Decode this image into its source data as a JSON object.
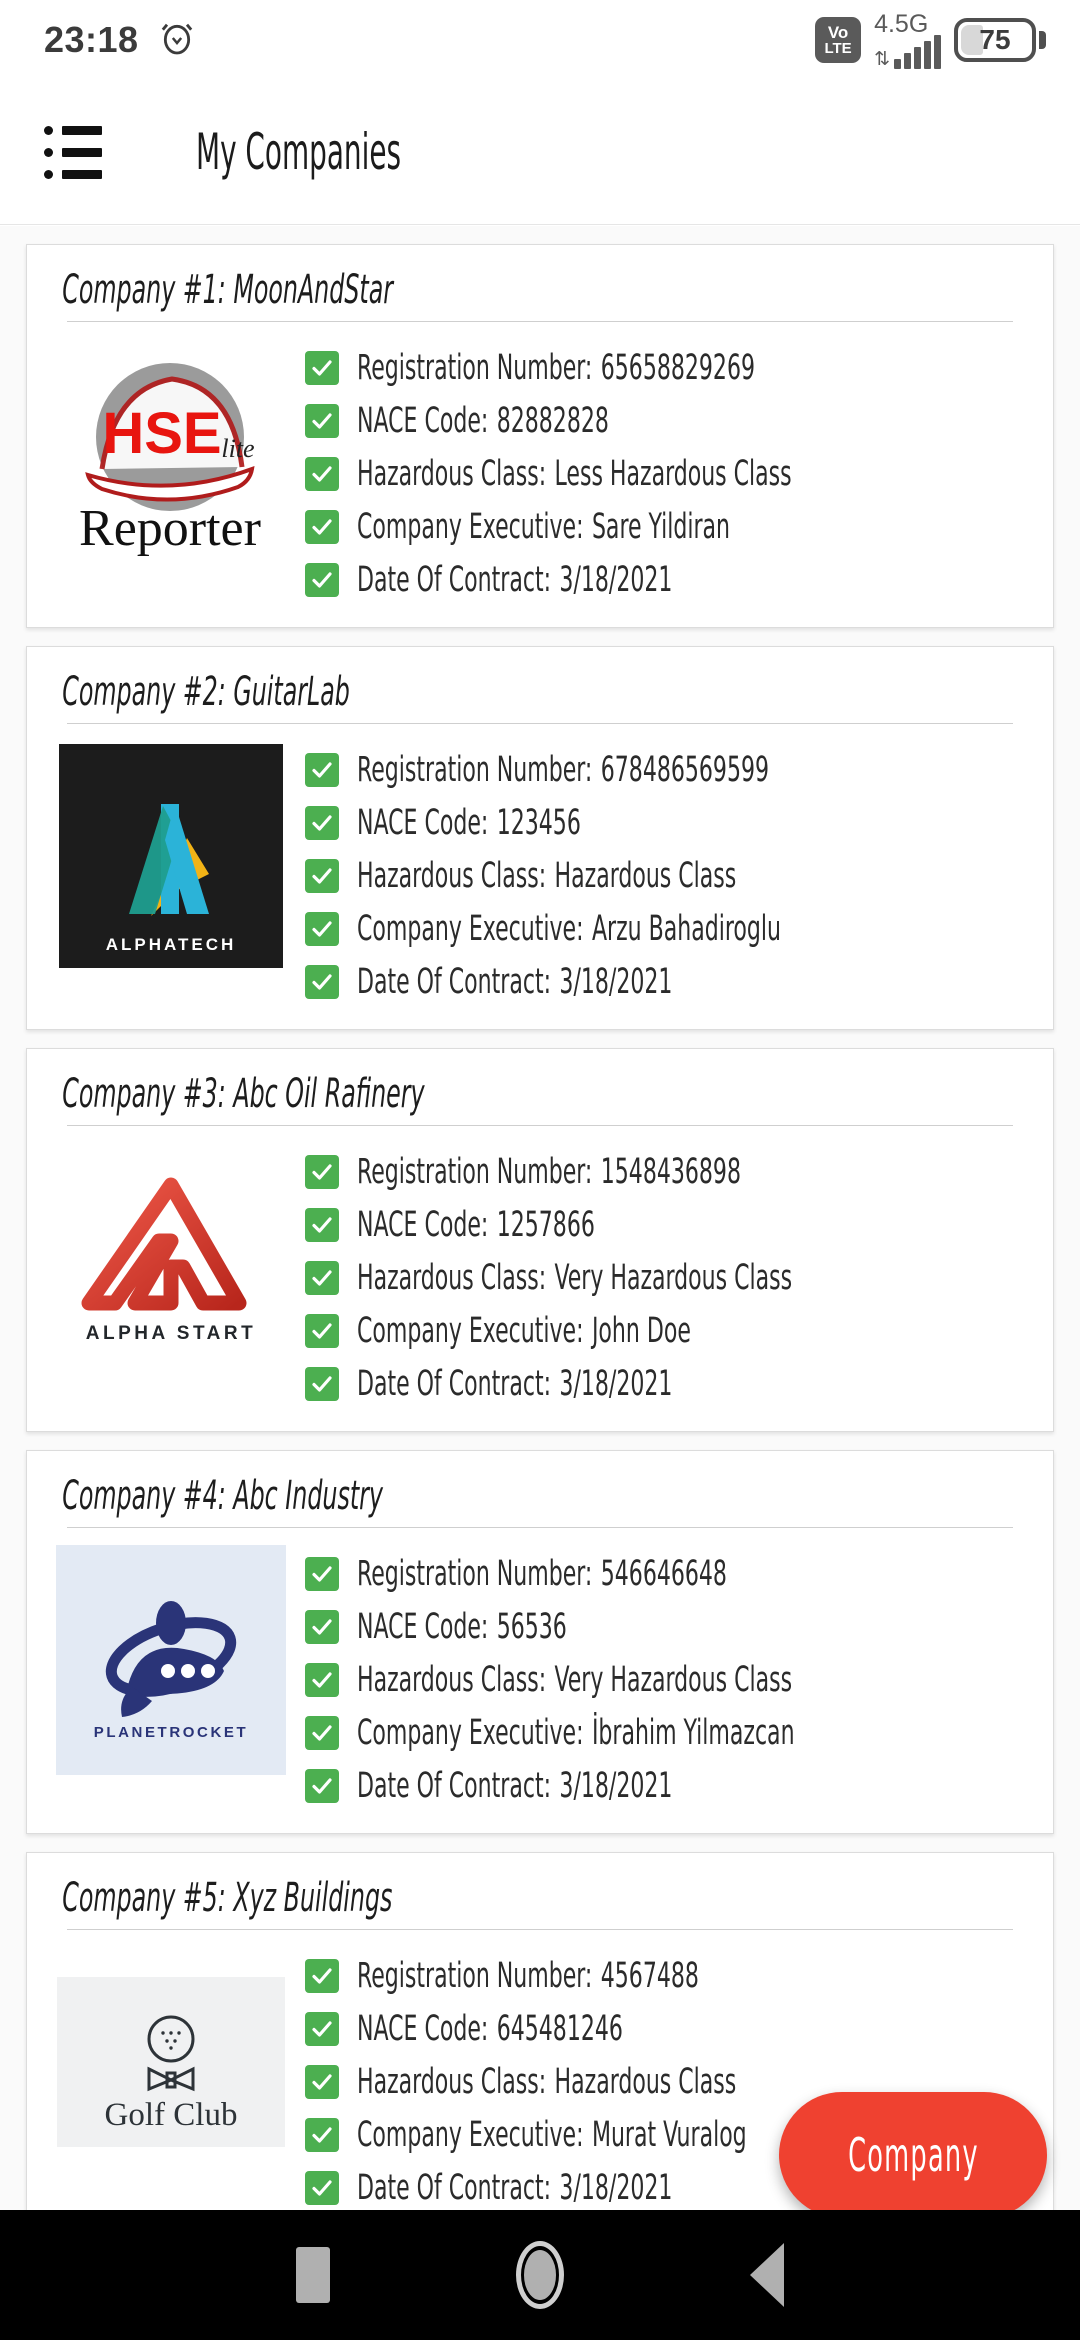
{
  "status_bar": {
    "time": "23:18",
    "alarm_icon": "alarm-clock-icon",
    "volte_top": "Vo",
    "volte_bottom": "LTE",
    "network_label": "4.5G",
    "battery_percent": "75"
  },
  "app_bar": {
    "menu_icon": "list-menu-icon",
    "title": "My Companies"
  },
  "field_labels": {
    "registration": "Registration Number:",
    "nace": "NACE Code:",
    "hazardous": "Hazardous Class:",
    "executive": "Company Executive:",
    "contract": "Date Of Contract:"
  },
  "companies": [
    {
      "title": "Company #1: MoonAndStar",
      "logo": "hse-lite-reporter-logo",
      "registration_number": "65658829269",
      "nace_code": "82882828",
      "hazardous_class": "Less Hazardous Class",
      "company_executive": "Sare Yildiran",
      "date_of_contract": "3/18/2021"
    },
    {
      "title": "Company #2: GuitarLab",
      "logo": "alphatech-logo",
      "registration_number": "678486569599",
      "nace_code": "123456",
      "hazardous_class": "Hazardous Class",
      "company_executive": "Arzu Bahadiroglu",
      "date_of_contract": "3/18/2021"
    },
    {
      "title": "Company #3: Abc Oil Rafinery",
      "logo": "alpha-start-logo",
      "registration_number": "1548436898",
      "nace_code": "1257866",
      "hazardous_class": "Very Hazardous Class",
      "company_executive": "John Doe",
      "date_of_contract": "3/18/2021"
    },
    {
      "title": "Company #4: Abc Industry",
      "logo": "planetrocket-logo",
      "registration_number": "546646648",
      "nace_code": "56536",
      "hazardous_class": "Very Hazardous Class",
      "company_executive": "İbrahim Yilmazcan",
      "date_of_contract": "3/18/2021"
    },
    {
      "title": "Company #5: Xyz Buildings",
      "logo": "golf-club-logo",
      "registration_number": "4567488",
      "nace_code": "645481246",
      "hazardous_class": "Hazardous Class",
      "company_executive": "Murat Vuralog",
      "date_of_contract": "3/18/2021"
    }
  ],
  "fab": {
    "label": "Company",
    "color": "#ef4130"
  },
  "nav_bar": {
    "recents_icon": "square-recents-icon",
    "home_icon": "circle-home-icon",
    "back_icon": "triangle-back-icon"
  },
  "logo_text": {
    "alphatech": "ALPHATECH",
    "alpha_start": "ALPHA START",
    "planetrocket": "PLANETROCKET",
    "golf_club": "Golf Club",
    "hse": "HSE",
    "hse_lite": "lite",
    "hse_reporter": "Reporter"
  },
  "colors": {
    "check_green": "#4caf50",
    "fab_red": "#ef4130",
    "card_border": "#dcdcdc"
  }
}
